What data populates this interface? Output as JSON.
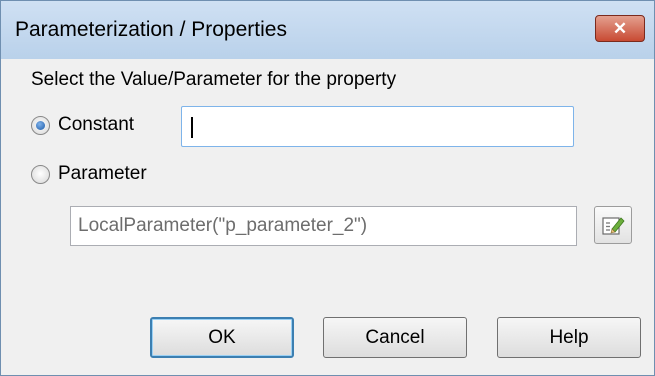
{
  "dialog": {
    "title": "Parameterization / Properties",
    "close_glyph": "✕"
  },
  "content": {
    "prompt": "Select the Value/Parameter for the property",
    "options": [
      {
        "label": "Constant",
        "selected": true
      },
      {
        "label": "Parameter",
        "selected": false
      }
    ],
    "constant_value": "",
    "parameter_value": "LocalParameter(\"p_parameter_2\")",
    "edit_icon": "edit-parameter-icon"
  },
  "buttons": {
    "ok": "OK",
    "cancel": "Cancel",
    "help": "Help"
  },
  "colors": {
    "close_button": "#c84a33",
    "radio_selected": "#1c5aa8",
    "focus_border": "#7eb4ea"
  }
}
